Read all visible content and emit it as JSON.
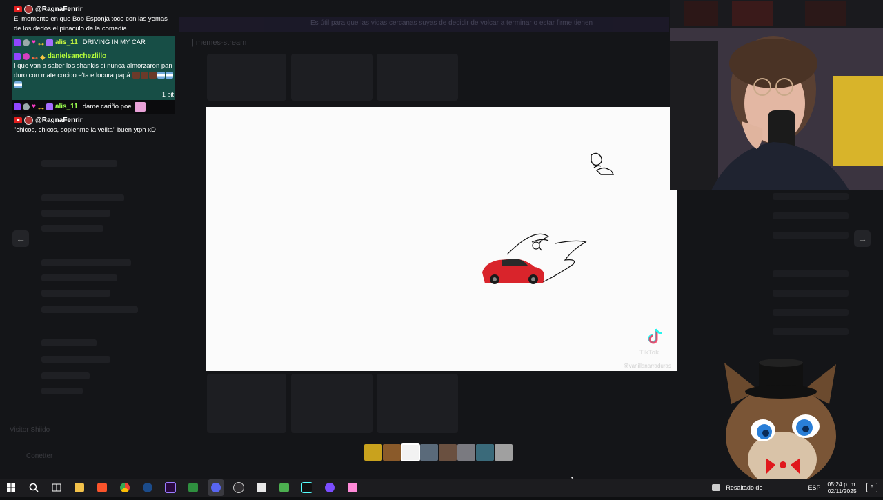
{
  "background_app": {
    "banner_text": "Es útil para que las vidas cercanas suyas de decidir de volcar a terminar o estar firme tienen",
    "channel_title": "| memes-stream",
    "bottom_user_name": "Visitor Shiido",
    "bottom_user2_name": "Conetter"
  },
  "chat": {
    "messages": [
      {
        "platform": "youtube",
        "user": "@RagnaFenrir",
        "text": "El momento en que Bob Esponja toco con las yemas de los dedos el pinaculo de la comedia",
        "highlight": false
      },
      {
        "platform": "twitch",
        "user": "alis_11",
        "text": "DRIVING IN MY CAR",
        "highlight": true
      },
      {
        "platform": "twitch",
        "user": "danielsanchezlillo",
        "text": "I que van a saber los shankis si nunca almorzaron pan duro con mate cocido e'ta e locura papá",
        "highlight": true,
        "bits_label": "1 bit"
      },
      {
        "platform": "twitch",
        "user": "alis_11",
        "text": "dame cariño poe",
        "highlight": false
      },
      {
        "platform": "youtube",
        "user": "@RagnaFenrir",
        "text": "\"chicos, chicos, soplenme la velita\" buen ytph xD",
        "highlight": false
      }
    ]
  },
  "viewer": {
    "nav_prev": "←",
    "nav_next": "→",
    "tiktok_text": "TikTok",
    "watermark": "@vanillanarraduras"
  },
  "taskbar": {
    "icons": [
      "windows-start-icon",
      "search-icon",
      "task-view-icon",
      "file-explorer-icon",
      "brave-icon",
      "chrome-icon",
      "steam-icon",
      "premiere-icon",
      "app-icon",
      "discord-icon",
      "obs-icon",
      "app-icon-2",
      "app-icon-3",
      "capcut-icon",
      "app-icon-4",
      "app-icon-5"
    ],
    "tray_label": "Resaltado de ",
    "language": "ESP",
    "time": "05:24 p. m.",
    "date": "02/11/2025",
    "notification_count": "6"
  }
}
